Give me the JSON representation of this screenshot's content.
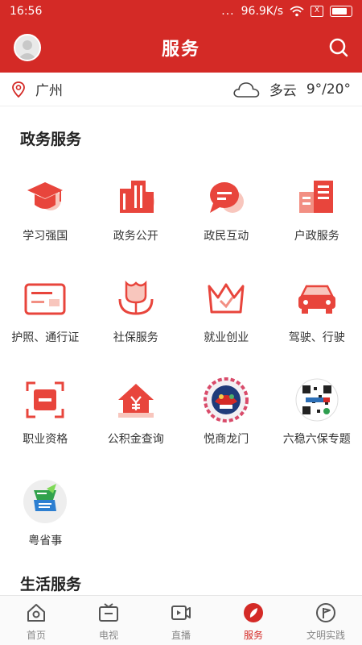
{
  "status_bar": {
    "time": "16:56",
    "dots": "...",
    "speed": "96.9K/s",
    "sim": "X"
  },
  "header": {
    "title": "服务",
    "avatar_icon": "avatar",
    "search_icon": "search-icon"
  },
  "weather": {
    "city": "广州",
    "condition": "多云",
    "temperature": "9°/20°",
    "location_icon": "location-pin-icon",
    "weather_icon": "cloud-icon"
  },
  "sections": {
    "gov": {
      "title": "政务服务",
      "items": [
        {
          "label": "学习强国",
          "icon": "graduation-cap-icon"
        },
        {
          "label": "政务公开",
          "icon": "buildings-icon"
        },
        {
          "label": "政民互动",
          "icon": "chat-bubble-icon"
        },
        {
          "label": "户政服务",
          "icon": "city-blocks-icon"
        },
        {
          "label": "护照、通行证",
          "icon": "passport-card-icon"
        },
        {
          "label": "社保服务",
          "icon": "lotus-hand-icon"
        },
        {
          "label": "就业创业",
          "icon": "crown-check-icon"
        },
        {
          "label": "驾驶、行驶",
          "icon": "car-icon"
        },
        {
          "label": "职业资格",
          "icon": "certificate-frame-icon"
        },
        {
          "label": "公积金查询",
          "icon": "house-yuan-icon"
        },
        {
          "label": "悦商龙门",
          "icon": "yueshang-logo-icon"
        },
        {
          "label": "六稳六保专题",
          "icon": "qr-code-icon"
        },
        {
          "label": "粤省事",
          "icon": "yueshengshi-logo-icon"
        }
      ]
    },
    "life": {
      "title": "生活服务"
    }
  },
  "tabs": [
    {
      "label": "首页",
      "icon": "home-icon"
    },
    {
      "label": "电视",
      "icon": "tv-icon"
    },
    {
      "label": "直播",
      "icon": "live-video-icon"
    },
    {
      "label": "服务",
      "icon": "compass-leaf-icon",
      "active": true
    },
    {
      "label": "文明实践",
      "icon": "flag-circle-icon"
    }
  ],
  "colors": {
    "brand": "#d42a26",
    "icon_red": "#e8453c",
    "icon_light": "#f8c6bd"
  }
}
